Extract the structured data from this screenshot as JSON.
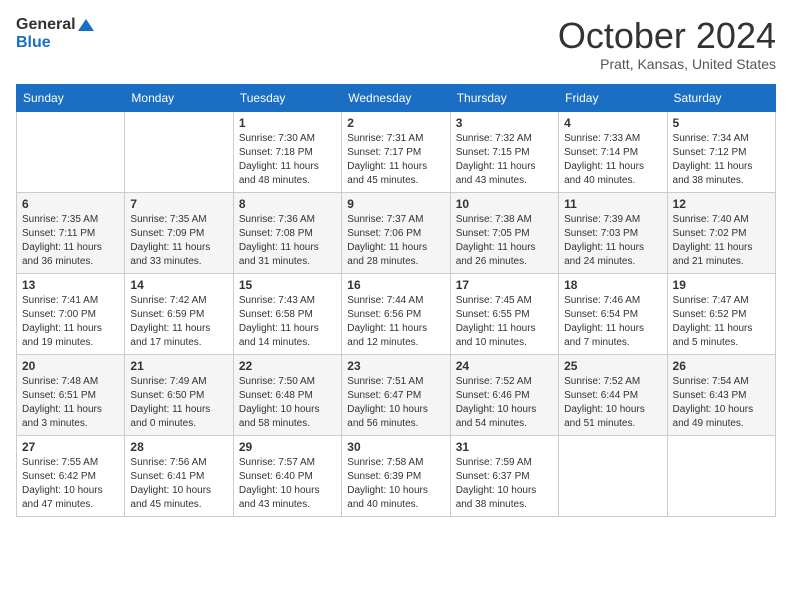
{
  "header": {
    "logo_line1": "General",
    "logo_line2": "Blue",
    "month": "October 2024",
    "location": "Pratt, Kansas, United States"
  },
  "weekdays": [
    "Sunday",
    "Monday",
    "Tuesday",
    "Wednesday",
    "Thursday",
    "Friday",
    "Saturday"
  ],
  "weeks": [
    [
      {
        "day": "",
        "sunrise": "",
        "sunset": "",
        "daylight": ""
      },
      {
        "day": "",
        "sunrise": "",
        "sunset": "",
        "daylight": ""
      },
      {
        "day": "1",
        "sunrise": "Sunrise: 7:30 AM",
        "sunset": "Sunset: 7:18 PM",
        "daylight": "Daylight: 11 hours and 48 minutes."
      },
      {
        "day": "2",
        "sunrise": "Sunrise: 7:31 AM",
        "sunset": "Sunset: 7:17 PM",
        "daylight": "Daylight: 11 hours and 45 minutes."
      },
      {
        "day": "3",
        "sunrise": "Sunrise: 7:32 AM",
        "sunset": "Sunset: 7:15 PM",
        "daylight": "Daylight: 11 hours and 43 minutes."
      },
      {
        "day": "4",
        "sunrise": "Sunrise: 7:33 AM",
        "sunset": "Sunset: 7:14 PM",
        "daylight": "Daylight: 11 hours and 40 minutes."
      },
      {
        "day": "5",
        "sunrise": "Sunrise: 7:34 AM",
        "sunset": "Sunset: 7:12 PM",
        "daylight": "Daylight: 11 hours and 38 minutes."
      }
    ],
    [
      {
        "day": "6",
        "sunrise": "Sunrise: 7:35 AM",
        "sunset": "Sunset: 7:11 PM",
        "daylight": "Daylight: 11 hours and 36 minutes."
      },
      {
        "day": "7",
        "sunrise": "Sunrise: 7:35 AM",
        "sunset": "Sunset: 7:09 PM",
        "daylight": "Daylight: 11 hours and 33 minutes."
      },
      {
        "day": "8",
        "sunrise": "Sunrise: 7:36 AM",
        "sunset": "Sunset: 7:08 PM",
        "daylight": "Daylight: 11 hours and 31 minutes."
      },
      {
        "day": "9",
        "sunrise": "Sunrise: 7:37 AM",
        "sunset": "Sunset: 7:06 PM",
        "daylight": "Daylight: 11 hours and 28 minutes."
      },
      {
        "day": "10",
        "sunrise": "Sunrise: 7:38 AM",
        "sunset": "Sunset: 7:05 PM",
        "daylight": "Daylight: 11 hours and 26 minutes."
      },
      {
        "day": "11",
        "sunrise": "Sunrise: 7:39 AM",
        "sunset": "Sunset: 7:03 PM",
        "daylight": "Daylight: 11 hours and 24 minutes."
      },
      {
        "day": "12",
        "sunrise": "Sunrise: 7:40 AM",
        "sunset": "Sunset: 7:02 PM",
        "daylight": "Daylight: 11 hours and 21 minutes."
      }
    ],
    [
      {
        "day": "13",
        "sunrise": "Sunrise: 7:41 AM",
        "sunset": "Sunset: 7:00 PM",
        "daylight": "Daylight: 11 hours and 19 minutes."
      },
      {
        "day": "14",
        "sunrise": "Sunrise: 7:42 AM",
        "sunset": "Sunset: 6:59 PM",
        "daylight": "Daylight: 11 hours and 17 minutes."
      },
      {
        "day": "15",
        "sunrise": "Sunrise: 7:43 AM",
        "sunset": "Sunset: 6:58 PM",
        "daylight": "Daylight: 11 hours and 14 minutes."
      },
      {
        "day": "16",
        "sunrise": "Sunrise: 7:44 AM",
        "sunset": "Sunset: 6:56 PM",
        "daylight": "Daylight: 11 hours and 12 minutes."
      },
      {
        "day": "17",
        "sunrise": "Sunrise: 7:45 AM",
        "sunset": "Sunset: 6:55 PM",
        "daylight": "Daylight: 11 hours and 10 minutes."
      },
      {
        "day": "18",
        "sunrise": "Sunrise: 7:46 AM",
        "sunset": "Sunset: 6:54 PM",
        "daylight": "Daylight: 11 hours and 7 minutes."
      },
      {
        "day": "19",
        "sunrise": "Sunrise: 7:47 AM",
        "sunset": "Sunset: 6:52 PM",
        "daylight": "Daylight: 11 hours and 5 minutes."
      }
    ],
    [
      {
        "day": "20",
        "sunrise": "Sunrise: 7:48 AM",
        "sunset": "Sunset: 6:51 PM",
        "daylight": "Daylight: 11 hours and 3 minutes."
      },
      {
        "day": "21",
        "sunrise": "Sunrise: 7:49 AM",
        "sunset": "Sunset: 6:50 PM",
        "daylight": "Daylight: 11 hours and 0 minutes."
      },
      {
        "day": "22",
        "sunrise": "Sunrise: 7:50 AM",
        "sunset": "Sunset: 6:48 PM",
        "daylight": "Daylight: 10 hours and 58 minutes."
      },
      {
        "day": "23",
        "sunrise": "Sunrise: 7:51 AM",
        "sunset": "Sunset: 6:47 PM",
        "daylight": "Daylight: 10 hours and 56 minutes."
      },
      {
        "day": "24",
        "sunrise": "Sunrise: 7:52 AM",
        "sunset": "Sunset: 6:46 PM",
        "daylight": "Daylight: 10 hours and 54 minutes."
      },
      {
        "day": "25",
        "sunrise": "Sunrise: 7:52 AM",
        "sunset": "Sunset: 6:44 PM",
        "daylight": "Daylight: 10 hours and 51 minutes."
      },
      {
        "day": "26",
        "sunrise": "Sunrise: 7:54 AM",
        "sunset": "Sunset: 6:43 PM",
        "daylight": "Daylight: 10 hours and 49 minutes."
      }
    ],
    [
      {
        "day": "27",
        "sunrise": "Sunrise: 7:55 AM",
        "sunset": "Sunset: 6:42 PM",
        "daylight": "Daylight: 10 hours and 47 minutes."
      },
      {
        "day": "28",
        "sunrise": "Sunrise: 7:56 AM",
        "sunset": "Sunset: 6:41 PM",
        "daylight": "Daylight: 10 hours and 45 minutes."
      },
      {
        "day": "29",
        "sunrise": "Sunrise: 7:57 AM",
        "sunset": "Sunset: 6:40 PM",
        "daylight": "Daylight: 10 hours and 43 minutes."
      },
      {
        "day": "30",
        "sunrise": "Sunrise: 7:58 AM",
        "sunset": "Sunset: 6:39 PM",
        "daylight": "Daylight: 10 hours and 40 minutes."
      },
      {
        "day": "31",
        "sunrise": "Sunrise: 7:59 AM",
        "sunset": "Sunset: 6:37 PM",
        "daylight": "Daylight: 10 hours and 38 minutes."
      },
      {
        "day": "",
        "sunrise": "",
        "sunset": "",
        "daylight": ""
      },
      {
        "day": "",
        "sunrise": "",
        "sunset": "",
        "daylight": ""
      }
    ]
  ]
}
